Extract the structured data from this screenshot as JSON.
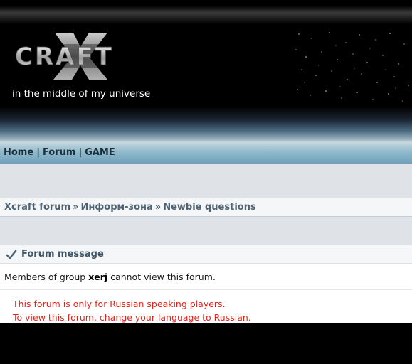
{
  "header": {
    "logo_text": "CRAFT",
    "tagline": "in the middle of my universe"
  },
  "nav": {
    "items": [
      "Home",
      "Forum",
      "GAME"
    ],
    "separator": "|"
  },
  "breadcrumb": {
    "items": [
      "Xcraft forum",
      "Информ-зона",
      "Newbie questions"
    ],
    "separator": "»"
  },
  "message": {
    "title": "Forum message",
    "text_before": "Members of group ",
    "group": "xerj",
    "text_after": " cannot view this forum.",
    "notice_line1": "This forum is only for Russian speaking players.",
    "notice_line2": "To view this forum, change your language to Russian."
  },
  "colors": {
    "notice_red": "#e0241c",
    "nav_text": "#1b2f3c",
    "breadcrumb_text": "#4e6373"
  }
}
